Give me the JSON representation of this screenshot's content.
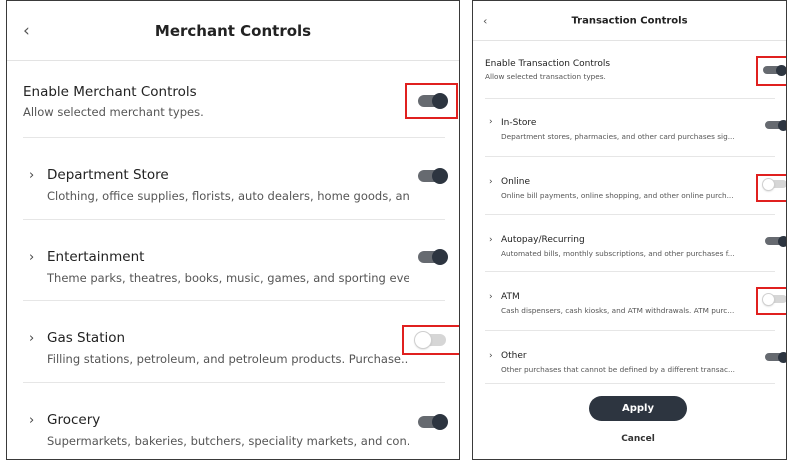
{
  "merchant": {
    "title": "Merchant Controls",
    "back_icon": "chevron-left-icon",
    "master": {
      "name": "Enable Merchant Controls",
      "desc": "Allow selected merchant types.",
      "enabled": true
    },
    "items": [
      {
        "name": "Department Store",
        "desc": "Clothing, office supplies, florists, auto dealers, home goods, an...",
        "enabled": true
      },
      {
        "name": "Entertainment",
        "desc": "Theme parks, theatres, books, music, games, and sporting eve...",
        "enabled": true
      },
      {
        "name": "Gas Station",
        "desc": "Filling stations, petroleum, and petroleum products. Purchase...",
        "enabled": false
      },
      {
        "name": "Grocery",
        "desc": "Supermarkets, bakeries, butchers, speciality markets, and con...",
        "enabled": true
      }
    ]
  },
  "transaction": {
    "title": "Transaction Controls",
    "back_icon": "chevron-left-icon",
    "master": {
      "name": "Enable Transaction Controls",
      "desc": "Allow selected transaction types.",
      "enabled": true
    },
    "items": [
      {
        "name": "In-Store",
        "desc": "Department stores, pharmacies, and other card purchases sig...",
        "enabled": true
      },
      {
        "name": "Online",
        "desc": "Online bill payments, online shopping, and other online purch...",
        "enabled": false
      },
      {
        "name": "Autopay/Recurring",
        "desc": "Automated bills, monthly subscriptions, and other purchases f...",
        "enabled": true
      },
      {
        "name": "ATM",
        "desc": "Cash dispensers, cash kiosks, and ATM withdrawals. ATM purc...",
        "enabled": false
      },
      {
        "name": "Other",
        "desc": "Other purchases that cannot be defined by a different transac...",
        "enabled": true
      }
    ],
    "apply_label": "Apply",
    "cancel_label": "Cancel"
  },
  "colors": {
    "highlight": "#e0201f",
    "toggle_on": "#2d3540",
    "toggle_off": "#d6d6d6"
  }
}
